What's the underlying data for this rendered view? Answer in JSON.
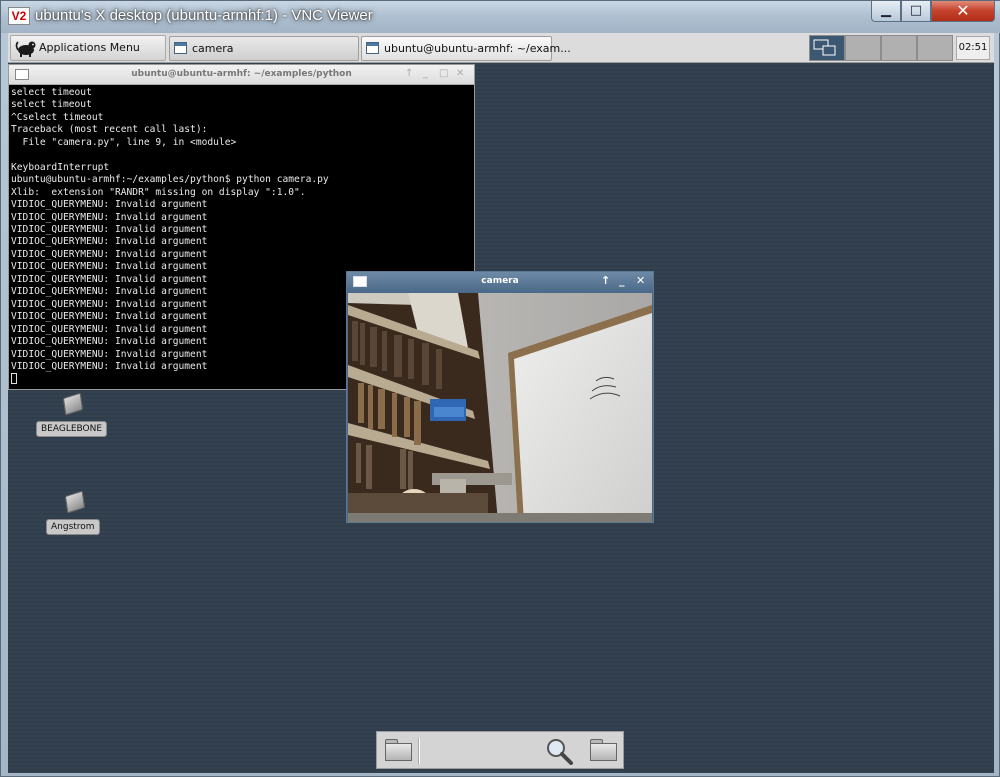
{
  "viewer": {
    "title": "ubuntu's X desktop (ubuntu-armhf:1) - VNC Viewer",
    "logo_text": "V2",
    "minimize": "▁",
    "maximize": "□",
    "close": "✕"
  },
  "panel": {
    "apps_menu_label": "Applications Menu",
    "tasks": [
      "camera",
      "ubuntu@ubuntu-armhf: ~/exam..."
    ],
    "workspace_count": 4,
    "active_workspace": 1,
    "clock": "02:51"
  },
  "terminal": {
    "title": "ubuntu@ubuntu-armhf: ~/examples/python",
    "buttons": {
      "up": "↑",
      "min": "_",
      "max": "□",
      "close": "✕"
    },
    "lines": [
      "select timeout",
      "select timeout",
      "^Cselect timeout",
      "Traceback (most recent call last):",
      "  File \"camera.py\", line 9, in <module>",
      "",
      "KeyboardInterrupt",
      "ubuntu@ubuntu-armhf:~/examples/python$ python camera.py",
      "Xlib:  extension \"RANDR\" missing on display \":1.0\".",
      "VIDIOC_QUERYMENU: Invalid argument",
      "VIDIOC_QUERYMENU: Invalid argument",
      "VIDIOC_QUERYMENU: Invalid argument",
      "VIDIOC_QUERYMENU: Invalid argument",
      "VIDIOC_QUERYMENU: Invalid argument",
      "VIDIOC_QUERYMENU: Invalid argument",
      "VIDIOC_QUERYMENU: Invalid argument",
      "VIDIOC_QUERYMENU: Invalid argument",
      "VIDIOC_QUERYMENU: Invalid argument",
      "VIDIOC_QUERYMENU: Invalid argument",
      "VIDIOC_QUERYMENU: Invalid argument",
      "VIDIOC_QUERYMENU: Invalid argument",
      "VIDIOC_QUERYMENU: Invalid argument",
      "VIDIOC_QUERYMENU: Invalid argument"
    ]
  },
  "camera": {
    "title": "camera",
    "buttons": {
      "up": "↑",
      "min": "_",
      "close": "✕"
    },
    "whiteboard_scribble": "(x,y)"
  },
  "desktop_icons": [
    {
      "label": "BEAGLEBONE",
      "icon": "drive-icon"
    },
    {
      "label": "Angstrom",
      "icon": "drive-icon"
    }
  ],
  "dock": {
    "items": [
      "folder-icon",
      "search-icon",
      "folder-icon"
    ]
  }
}
